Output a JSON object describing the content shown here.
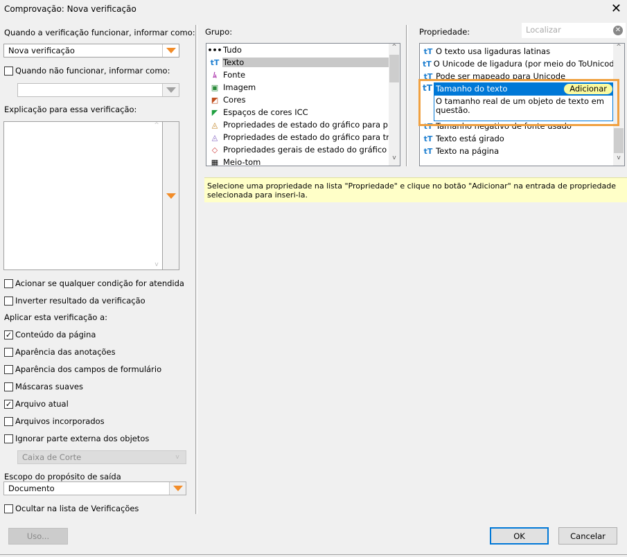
{
  "window": {
    "title": "Comprovação: Nova verificação",
    "close_icon": "close-icon"
  },
  "left": {
    "report_label": "Quando a verificação funcionar, informar como:",
    "report_value": "Nova verificação",
    "fail_checkbox": {
      "label": "Quando não funcionar, informar como:",
      "checked": false
    },
    "fail_value": "",
    "explanation_label": "Explicação para essa verificação:",
    "explanation_value": "",
    "options": [
      {
        "label": "Acionar se qualquer condição for atendida",
        "checked": false
      },
      {
        "label": "Inverter resultado da verificação",
        "checked": false
      }
    ],
    "apply_label": "Aplicar esta verificação a:",
    "apply_items": [
      {
        "label": "Conteúdo da página",
        "checked": true
      },
      {
        "label": "Aparência das anotações",
        "checked": false
      },
      {
        "label": "Aparência dos campos de formulário",
        "checked": false
      },
      {
        "label": "Máscaras suaves",
        "checked": false
      },
      {
        "label": "Arquivo atual",
        "checked": true
      },
      {
        "label": "Arquivos incorporados",
        "checked": false
      },
      {
        "label": "Ignorar parte externa dos objetos",
        "checked": false
      }
    ],
    "box_value": "Caixa de Corte",
    "scope_label": "Escopo do propósito de saída",
    "scope_value": "Documento",
    "hide_checkbox": {
      "label": "Ocultar na lista de Verificações",
      "checked": false
    },
    "usage_button": "Uso..."
  },
  "group": {
    "label": "Grupo:",
    "items": [
      {
        "label": "Tudo",
        "icon": "ellipsis-icon"
      },
      {
        "label": "Texto",
        "icon": "text-icon",
        "selected": true
      },
      {
        "label": "Fonte",
        "icon": "font-icon"
      },
      {
        "label": "Imagem",
        "icon": "image-icon"
      },
      {
        "label": "Cores",
        "icon": "colors-icon"
      },
      {
        "label": "Espaços de cores ICC",
        "icon": "icc-icon"
      },
      {
        "label": "Propriedades de estado do gráfico para preenc",
        "icon": "fill-state-icon"
      },
      {
        "label": "Propriedades de estado do gráfico para traçad",
        "icon": "stroke-state-icon"
      },
      {
        "label": "Propriedades gerais de estado do gráfico",
        "icon": "graphic-state-icon"
      },
      {
        "label": "Meio-tom",
        "icon": "halftone-icon"
      }
    ]
  },
  "property": {
    "label": "Propriedade:",
    "search_placeholder": "Localizar",
    "items": [
      "O texto usa ligaduras latinas",
      "O Unicode de ligadura (por meio do ToUnicode C",
      "Pode ser mapeado para Unicode"
    ],
    "selected": {
      "label": "Tamanho do texto",
      "add_button": "Adicionar",
      "description": "O tamanho real de um objeto de texto em questão."
    },
    "items_after": [
      "Tamanho negativo de fonte usado",
      "Texto está girado",
      "Texto na página"
    ],
    "highlight_color": "#f0a040",
    "selection_color": "#0078d7"
  },
  "info": "Selecione uma propriedade na lista \"Propriedade\" e clique no botão \"Adicionar\" na entrada de propriedade selecionada para inseri-la.",
  "buttons": {
    "ok": "OK",
    "cancel": "Cancelar"
  }
}
